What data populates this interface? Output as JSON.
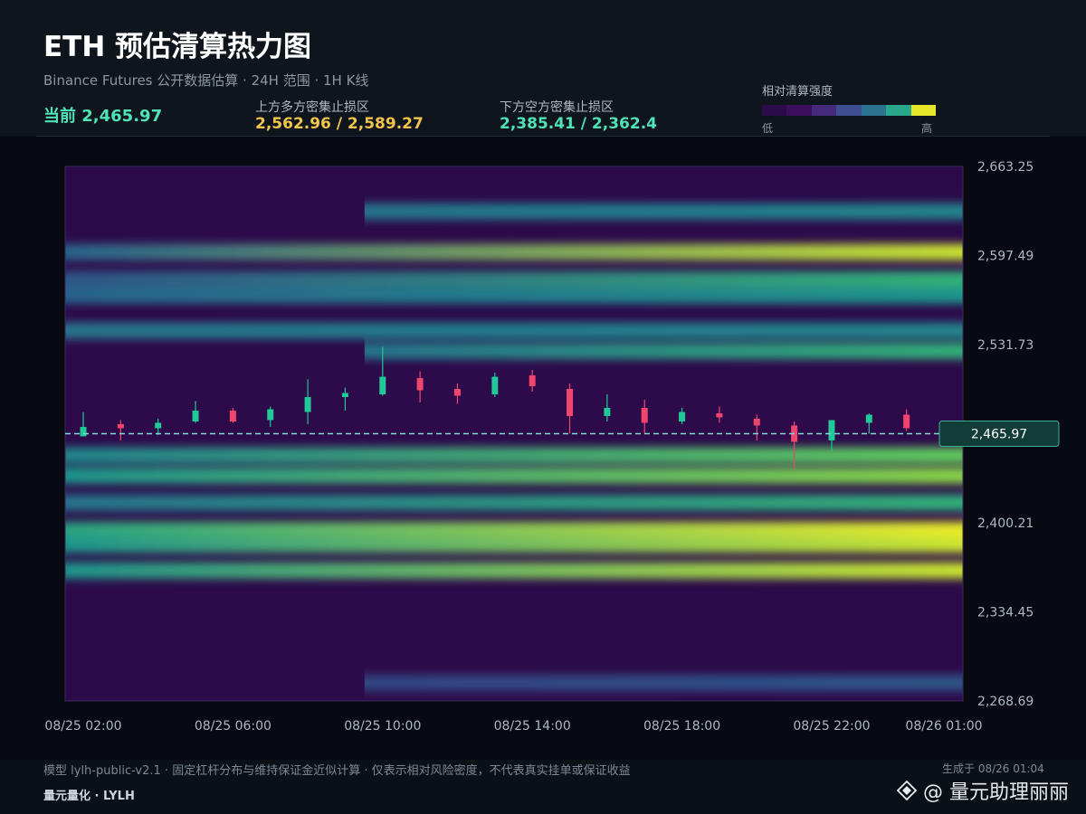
{
  "header": {
    "title": "ETH 预估清算热力图",
    "subtitle": "Binance Futures 公开数据估算 · 24H 范围 · 1H K线",
    "current_text": "当前 2,465.97",
    "upper_label": "上方多方密集止损区",
    "upper_value": "2,562.96 / 2,589.27",
    "lower_label": "下方空方密集止损区",
    "lower_value": "2,385.41 / 2,362.4"
  },
  "legend": {
    "title": "相对清算强度",
    "low": "低",
    "high": "高",
    "colors": [
      "#2d0a4a",
      "#3b0f5e",
      "#452a7a",
      "#3d4f8e",
      "#2b7290",
      "#2aa68a",
      "#e6e62a"
    ]
  },
  "footer": {
    "note": "模型 lylh-public-v2.1 · 固定杠杆分布与维持保证金近似计算 · 仅表示相对风险密度，不代表真实挂单或保证收益",
    "brand": "量元量化 · LYLH",
    "generated": "生成于 08/26 01:04",
    "watermark": "@ 量元助理丽丽"
  },
  "colors": {
    "up": "#20c997",
    "down": "#f0466e",
    "current_line": "#7fdbdb",
    "accent_green": "#4fe3b6",
    "accent_gold": "#f2c44d"
  },
  "chart_data": {
    "type": "heatmap",
    "title": "ETH 预估清算热力图",
    "ylim": [
      2268.69,
      2663.25
    ],
    "y_ticks": [
      "2,663.25",
      "2,597.49",
      "2,531.73",
      "2,465.97",
      "2,400.21",
      "2,334.45",
      "2,268.69"
    ],
    "x_ticks": [
      "08/25 02:00",
      "08/25 06:00",
      "08/25 10:00",
      "08/25 14:00",
      "08/25 18:00",
      "08/25 22:00",
      "08/26 01:00"
    ],
    "current_price": 2465.97,
    "current_label": "2,465.97",
    "candles": [
      {
        "t": "08/25 02:00",
        "o": 2464,
        "h": 2482,
        "l": 2465,
        "c": 2471
      },
      {
        "t": "08/25 03:00",
        "o": 2473,
        "h": 2476,
        "l": 2461,
        "c": 2470
      },
      {
        "t": "08/25 04:00",
        "o": 2470,
        "h": 2477,
        "l": 2465,
        "c": 2474
      },
      {
        "t": "08/25 05:00",
        "o": 2475,
        "h": 2490,
        "l": 2474,
        "c": 2483
      },
      {
        "t": "08/25 06:00",
        "o": 2483,
        "h": 2485,
        "l": 2474,
        "c": 2475
      },
      {
        "t": "08/25 07:00",
        "o": 2476,
        "h": 2486,
        "l": 2471,
        "c": 2484
      },
      {
        "t": "08/25 08:00",
        "o": 2482,
        "h": 2506,
        "l": 2473,
        "c": 2493
      },
      {
        "t": "08/25 09:00",
        "o": 2493,
        "h": 2500,
        "l": 2483,
        "c": 2496
      },
      {
        "t": "08/25 10:00",
        "o": 2495,
        "h": 2530,
        "l": 2494,
        "c": 2508
      },
      {
        "t": "08/25 11:00",
        "o": 2507,
        "h": 2512,
        "l": 2489,
        "c": 2498
      },
      {
        "t": "08/25 12:00",
        "o": 2499,
        "h": 2503,
        "l": 2488,
        "c": 2494
      },
      {
        "t": "08/25 13:00",
        "o": 2495,
        "h": 2511,
        "l": 2493,
        "c": 2508
      },
      {
        "t": "08/25 14:00",
        "o": 2509,
        "h": 2513,
        "l": 2497,
        "c": 2501
      },
      {
        "t": "08/25 15:00",
        "o": 2499,
        "h": 2503,
        "l": 2466,
        "c": 2479
      },
      {
        "t": "08/25 16:00",
        "o": 2479,
        "h": 2495,
        "l": 2475,
        "c": 2485
      },
      {
        "t": "08/25 17:00",
        "o": 2485,
        "h": 2491,
        "l": 2466,
        "c": 2474
      },
      {
        "t": "08/25 18:00",
        "o": 2475,
        "h": 2485,
        "l": 2473,
        "c": 2482
      },
      {
        "t": "08/25 19:00",
        "o": 2481,
        "h": 2486,
        "l": 2474,
        "c": 2478
      },
      {
        "t": "08/25 20:00",
        "o": 2477,
        "h": 2480,
        "l": 2461,
        "c": 2472
      },
      {
        "t": "08/25 21:00",
        "o": 2472,
        "h": 2475,
        "l": 2440,
        "c": 2460
      },
      {
        "t": "08/25 22:00",
        "o": 2461,
        "h": 2476,
        "l": 2453,
        "c": 2476
      },
      {
        "t": "08/25 23:00",
        "o": 2474,
        "h": 2481,
        "l": 2466,
        "c": 2480
      },
      {
        "t": "08/26 00:00",
        "o": 2480,
        "h": 2484,
        "l": 2468,
        "c": 2470
      }
    ],
    "heatmap_bands": [
      {
        "price": 2600,
        "t_start": "08/25 02:00",
        "t_end": "08/26 01:00",
        "intensity_start": 0.45,
        "intensity_end": 0.95
      },
      {
        "price": 2580,
        "t_start": "08/25 02:00",
        "t_end": "08/26 01:00",
        "intensity_start": 0.4,
        "intensity_end": 0.7
      },
      {
        "price": 2568,
        "t_start": "08/25 02:00",
        "t_end": "08/26 01:00",
        "intensity_start": 0.45,
        "intensity_end": 0.6
      },
      {
        "price": 2630,
        "t_start": "08/25 10:00",
        "t_end": "08/26 01:00",
        "intensity_start": 0.5,
        "intensity_end": 0.55
      },
      {
        "price": 2542,
        "t_start": "08/25 02:00",
        "t_end": "08/26 01:00",
        "intensity_start": 0.5,
        "intensity_end": 0.55
      },
      {
        "price": 2527,
        "t_start": "08/25 10:00",
        "t_end": "08/26 01:00",
        "intensity_start": 0.5,
        "intensity_end": 0.7
      },
      {
        "price": 2450,
        "t_start": "08/25 02:00",
        "t_end": "08/26 01:00",
        "intensity_start": 0.55,
        "intensity_end": 0.8
      },
      {
        "price": 2435,
        "t_start": "08/25 02:00",
        "t_end": "08/26 01:00",
        "intensity_start": 0.6,
        "intensity_end": 0.85
      },
      {
        "price": 2415,
        "t_start": "08/25 02:00",
        "t_end": "08/26 01:00",
        "intensity_start": 0.5,
        "intensity_end": 0.7
      },
      {
        "price": 2395,
        "t_start": "08/25 02:00",
        "t_end": "08/26 01:00",
        "intensity_start": 0.65,
        "intensity_end": 1.0
      },
      {
        "price": 2384,
        "t_start": "08/25 02:00",
        "t_end": "08/26 01:00",
        "intensity_start": 0.6,
        "intensity_end": 0.95
      },
      {
        "price": 2365,
        "t_start": "08/25 02:00",
        "t_end": "08/26 01:00",
        "intensity_start": 0.6,
        "intensity_end": 0.95
      },
      {
        "price": 2282,
        "t_start": "08/25 10:00",
        "t_end": "08/26 01:00",
        "intensity_start": 0.35,
        "intensity_end": 0.4
      }
    ]
  }
}
